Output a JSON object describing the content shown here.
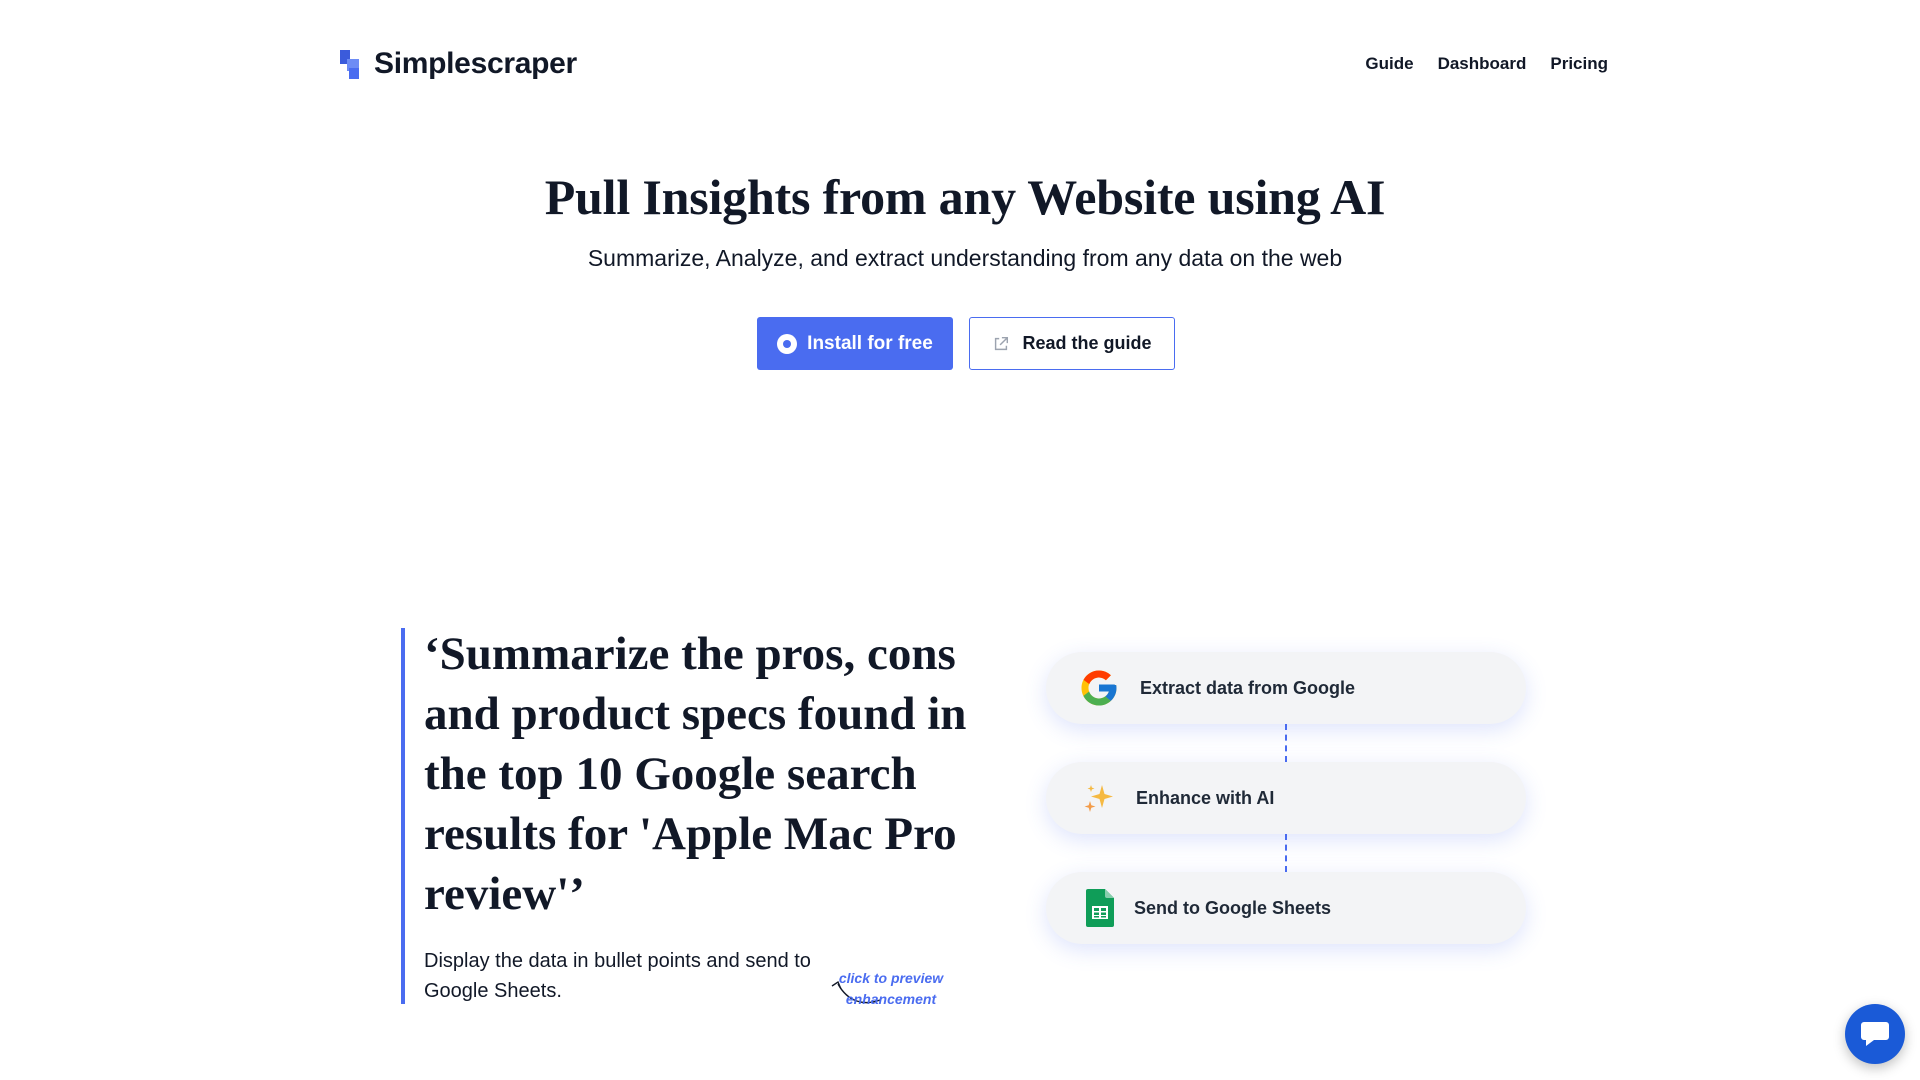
{
  "header": {
    "brand": "Simplescraper",
    "nav": [
      {
        "label": "Guide"
      },
      {
        "label": "Dashboard"
      },
      {
        "label": "Pricing"
      }
    ]
  },
  "hero": {
    "title": "Pull Insights from any Website using AI",
    "subtitle": "Summarize, Analyze, and extract understanding from any data on the web",
    "install_label": "Install for free",
    "guide_label": "Read the guide"
  },
  "example": {
    "quote": "‘Summarize the pros, cons and product specs found in the top 10 Google search results for 'Apple Mac Pro review'’",
    "description": "Display the data in bullet points and send to Google Sheets.",
    "hint": "click to preview enhancement"
  },
  "steps": [
    {
      "label": "Extract data from Google",
      "icon": "google-icon"
    },
    {
      "label": "Enhance with AI",
      "icon": "sparkle-icon"
    },
    {
      "label": "Send to Google Sheets",
      "icon": "google-sheets-icon"
    }
  ],
  "colors": {
    "accent": "#4a6cf0",
    "chat": "#1a5ad7"
  }
}
